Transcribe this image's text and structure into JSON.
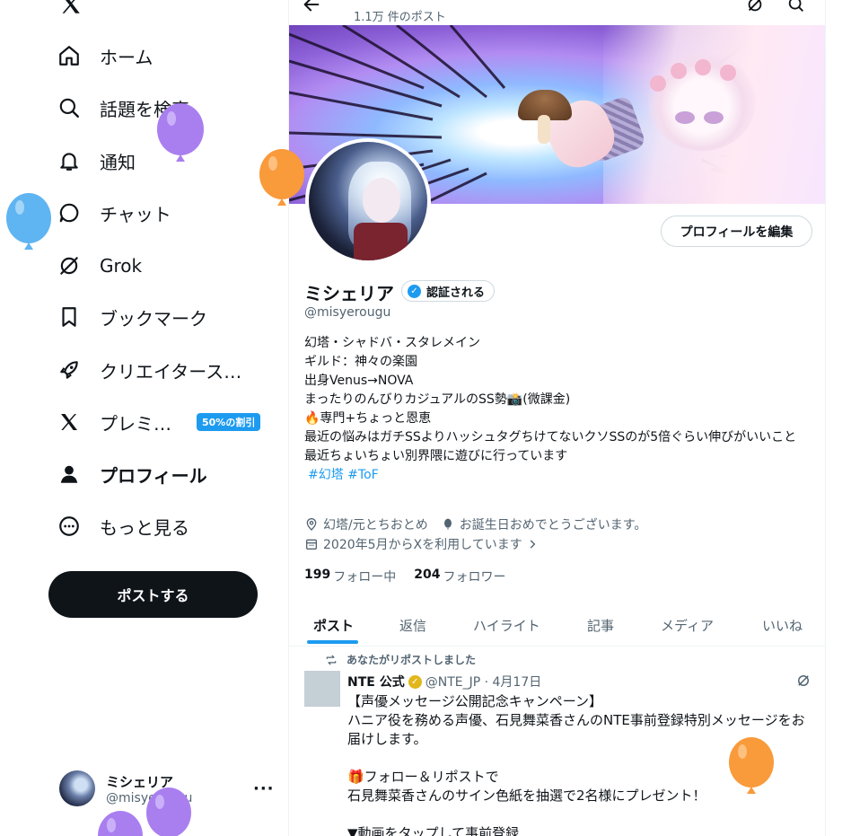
{
  "sidebar": {
    "nav": [
      {
        "label": "ホーム",
        "icon": "home-icon"
      },
      {
        "label": "話題を検索",
        "icon": "search-icon"
      },
      {
        "label": "通知",
        "icon": "bell-icon"
      },
      {
        "label": "チャット",
        "icon": "chat-icon"
      },
      {
        "label": "Grok",
        "icon": "grok-icon"
      },
      {
        "label": "ブックマーク",
        "icon": "bookmark-icon"
      },
      {
        "label": "クリエイタース…",
        "icon": "rocket-icon"
      },
      {
        "label": "プレミ…",
        "icon": "x-icon"
      },
      {
        "label": "プロフィール",
        "icon": "person-icon"
      },
      {
        "label": "もっと見る",
        "icon": "more-circle-icon"
      }
    ],
    "premium_badge": "50%の割引",
    "post_button": "ポストする",
    "account": {
      "name": "ミシェリア",
      "handle": "@misyerougu",
      "more": "···"
    }
  },
  "header": {
    "post_count": "1.1万 件のポスト"
  },
  "profile": {
    "edit_button": "プロフィールを編集",
    "name": "ミシェリア",
    "verified_label": "認証される",
    "handle": "@misyerougu",
    "bio": [
      "幻塔・シャドバ・スタレメイン",
      "ギルド：神々の楽園",
      "出身Venus→NOVA",
      "まったりのんびりカジュアルのSS勢📸(微課金)",
      "🔥専門+ちょっと恩恵",
      "最近の悩みはガチSSよりハッシュタグちけてないクソSSのが5倍ぐらい伸びがいいこと",
      "最近ちょいちょい別界隈に遊びに行っています"
    ],
    "hashtags": "#幻塔 #ToF",
    "location": "幻塔/元とちおとめ",
    "birthday": "お誕生日おめでとうございます。",
    "joined": "2020年5月からXを利用しています",
    "following_count": "199",
    "following_label": "フォロー中",
    "followers_count": "204",
    "followers_label": "フォロワー"
  },
  "tabs": [
    "ポスト",
    "返信",
    "ハイライト",
    "記事",
    "メディア",
    "いいね"
  ],
  "tweet": {
    "repost_note": "あなたがリポストしました",
    "author": "NTE 公式",
    "handle_date": "@NTE_JP · 4月17日",
    "lines": [
      "【声優メッセージ公開記念キャンペーン】",
      "ハニア役を務める声優、石見舞菜香さんのNTE事前登録特別メッセージをお届けします。",
      "",
      "🎁フォロー＆リポストで",
      "石見舞菜香さんのサイン色紙を抽選で2名様にプレゼント！",
      "",
      "▼動画をタップして事前登録"
    ]
  },
  "colors": {
    "accent": "#1d9bf0",
    "text": "#0f1419",
    "muted": "#536471",
    "balloon_purple": "#a97ff0",
    "balloon_orange": "#f99a3b",
    "balloon_blue": "#5fb4f2"
  }
}
